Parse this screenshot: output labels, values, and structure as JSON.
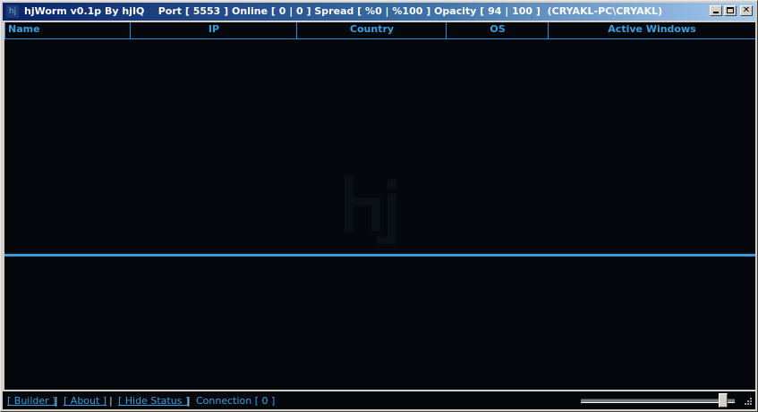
{
  "window": {
    "title": "hjWorm v0.1p By hjIQ    Port [ 5553 ] Online [ 0 | 0 ] Spread [ %0 | %100 ] Opacity [ 94 | 100 ]  (CRYAKL-PC\\CRYAKL)",
    "icon_label": "hj",
    "minimize_icon": "minimize-icon",
    "maximize_icon": "maximize-icon",
    "close_label": "✕"
  },
  "list": {
    "columns": [
      "Name",
      "IP",
      "Country",
      "OS",
      "Active Windows"
    ],
    "rows": []
  },
  "status": {
    "builder_link": "[ Builder ]",
    "about_link": "[ About ]",
    "hide_status_link": "[ Hide Status ]",
    "separator": "|",
    "connection_text": "Connection [ 0 ]",
    "opacity_slider_value": 0.94
  },
  "colors": {
    "accent": "#3aa0e0",
    "background": "#04080d",
    "splitter": "#3a9ad8"
  }
}
